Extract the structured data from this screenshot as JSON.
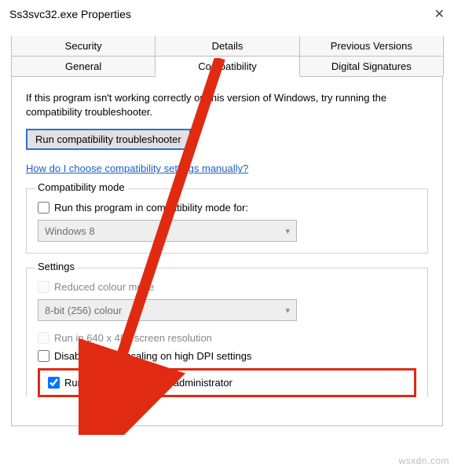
{
  "window": {
    "title": "Ss3svc32.exe Properties"
  },
  "tabs": {
    "row1": [
      "Security",
      "Details",
      "Previous Versions"
    ],
    "row2": [
      "General",
      "Compatibility",
      "Digital Signatures"
    ],
    "active": "Compatibility"
  },
  "intro": "If this program isn't working correctly on this version of Windows, try running the compatibility troubleshooter.",
  "troubleshooter_button": "Run compatibility troubleshooter",
  "help_link": "How do I choose compatibility settings manually?",
  "compat_mode": {
    "legend": "Compatibility mode",
    "checkbox_label": "Run this program in compatibility mode for:",
    "combo_value": "Windows 8"
  },
  "settings": {
    "legend": "Settings",
    "reduced_colour": "Reduced colour mode",
    "colour_combo": "8-bit (256) colour",
    "resolution": "Run in 640 x 480 screen resolution",
    "dpi": "Disable display scaling on high DPI settings",
    "admin": "Run this program as an administrator"
  },
  "watermark": "wsxdn.com"
}
